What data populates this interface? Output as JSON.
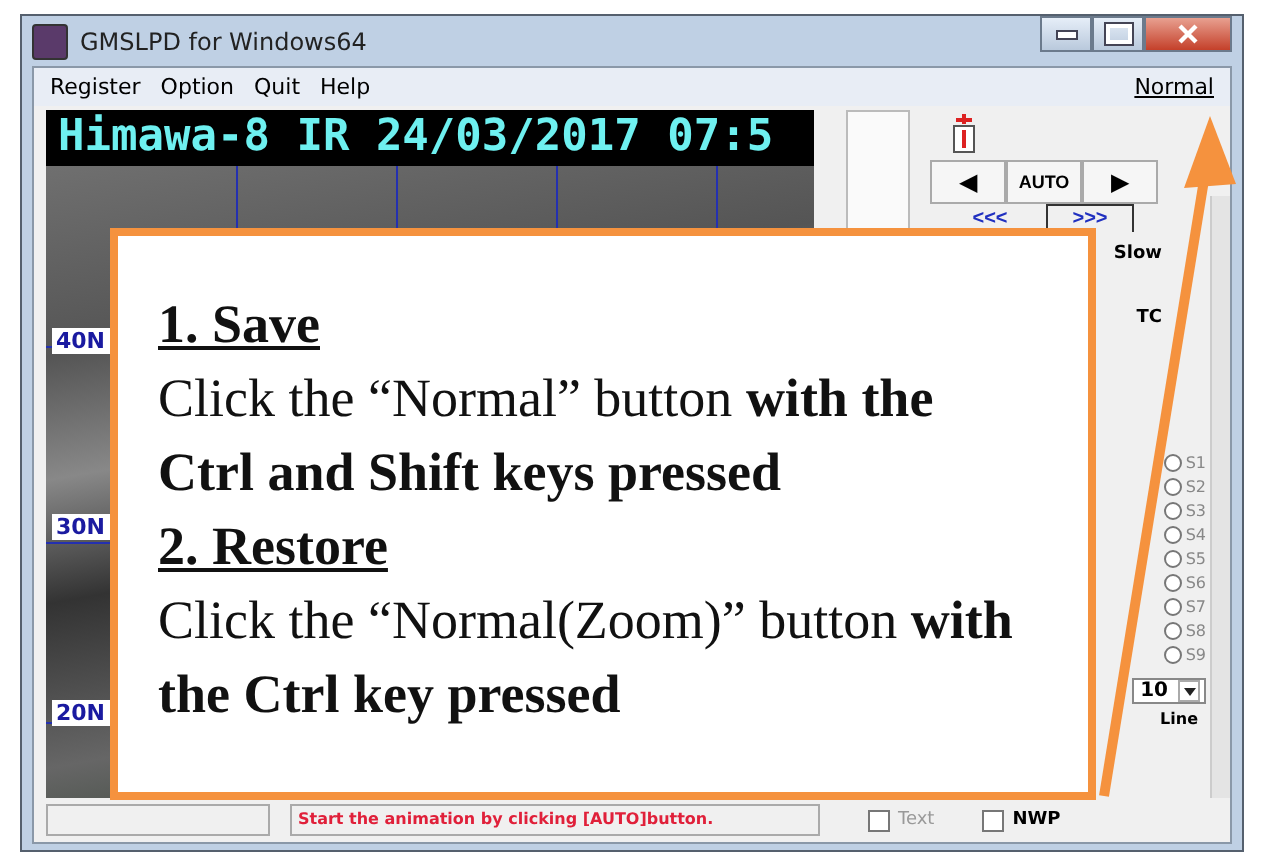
{
  "window": {
    "title": "GMSLPD for Windows64"
  },
  "menu": [
    {
      "label": "Register"
    },
    {
      "label": "Option"
    },
    {
      "label": "Quit"
    },
    {
      "label": "Help"
    }
  ],
  "normal_button": "Normal",
  "map": {
    "title": "Himawa-8 IR 24/03/2017 07:5",
    "lat_labels": [
      "40N",
      "30N",
      "20N"
    ]
  },
  "controls": {
    "play_buttons": [
      "◀",
      "AUTO",
      "▶"
    ],
    "step_buttons": [
      "<<<",
      ">>>"
    ],
    "speed_label": "Slow",
    "time_label": "TC",
    "stations": [
      {
        "label": "S1",
        "selected": false
      },
      {
        "label": "S2",
        "selected": false
      },
      {
        "label": "S3",
        "selected": false
      },
      {
        "label": "S4",
        "selected": false
      },
      {
        "label": "S5",
        "selected": false
      },
      {
        "label": "S6",
        "selected": false
      },
      {
        "label": "S7",
        "selected": false
      },
      {
        "label": "S8",
        "selected": false
      },
      {
        "label": "S9",
        "selected": false
      }
    ],
    "interval": "10",
    "line_label": "Line",
    "checkboxes": [
      {
        "label": "Text",
        "checked": false,
        "disabled": true
      },
      {
        "label": "NWP",
        "checked": false,
        "disabled": false
      }
    ]
  },
  "status_bar": {
    "message": "Start the animation by clicking [AUTO]button."
  },
  "callout": {
    "steps": [
      {
        "heading": "1. Save",
        "text": "Click the “Normal” button **with the Ctrl and Shift keys pressed**"
      },
      {
        "heading": "2. Restore",
        "text": "Click the “Normal(Zoom)” button **with the Ctrl key pressed**"
      }
    ]
  }
}
